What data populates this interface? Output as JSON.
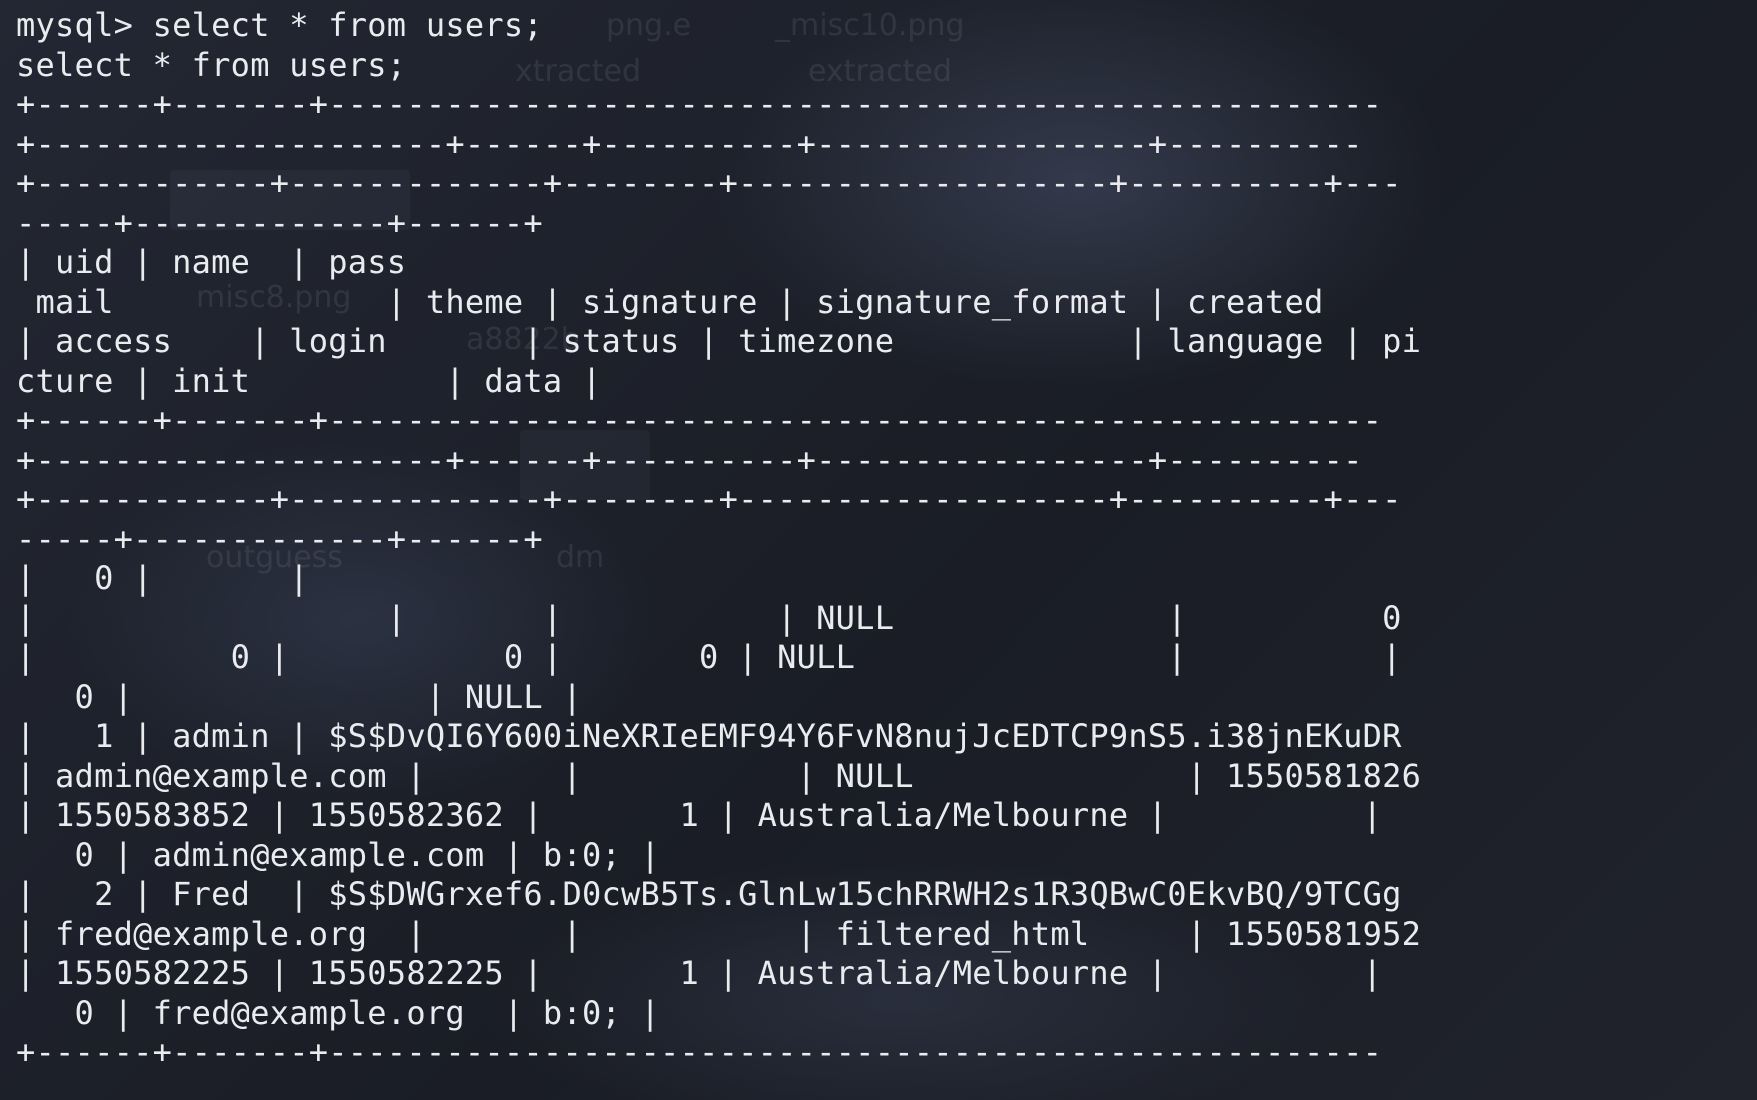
{
  "terminal": {
    "prompt": "mysql> ",
    "command": "select * from users;",
    "echo": "select * from users;",
    "output_lines": [
      "+------+-------+------------------------------------------------------",
      "+---------------------+------+----------+-----------------+----------",
      "+------------+-------------+--------+-------------------+----------+---",
      "-----+-------------+------+",
      "| uid | name  | pass",
      " mail              | theme | signature | signature_format | created",
      "| access    | login       | status | timezone            | language | pi",
      "cture | init          | data |",
      "+------+-------+------------------------------------------------------",
      "+---------------------+------+----------+-----------------+----------",
      "+------------+-------------+--------+-------------------+----------+---",
      "-----+-------------+------+",
      "|   0 |       |",
      "|                  |       |           | NULL              |          0",
      "|          0 |           0 |       0 | NULL                |          |",
      "   0 |               | NULL |",
      "|   1 | admin | $S$DvQI6Y600iNeXRIeEMF94Y6FvN8nujJcEDTCP9nS5.i38jnEKuDR",
      "| admin@example.com |       |           | NULL              | 1550581826",
      "| 1550583852 | 1550582362 |       1 | Australia/Melbourne |          |",
      "   0 | admin@example.com | b:0; |",
      "|   2 | Fred  | $S$DWGrxef6.D0cwB5Ts.GlnLw15chRRWH2s1R3QBwC0EkvBQ/9TCGg",
      "| fred@example.org  |       |           | filtered_html     | 1550581952",
      "| 1550582225 | 1550582225 |       1 | Australia/Melbourne |          |",
      "   0 | fred@example.org  | b:0; |",
      "+------+-------+------------------------------------------------------"
    ]
  },
  "background_labels": [
    "png.e",
    "_misc10.png",
    "xtracted",
    "extracted",
    "misc8.png",
    "a8822b",
    "outguess",
    "dm"
  ]
}
